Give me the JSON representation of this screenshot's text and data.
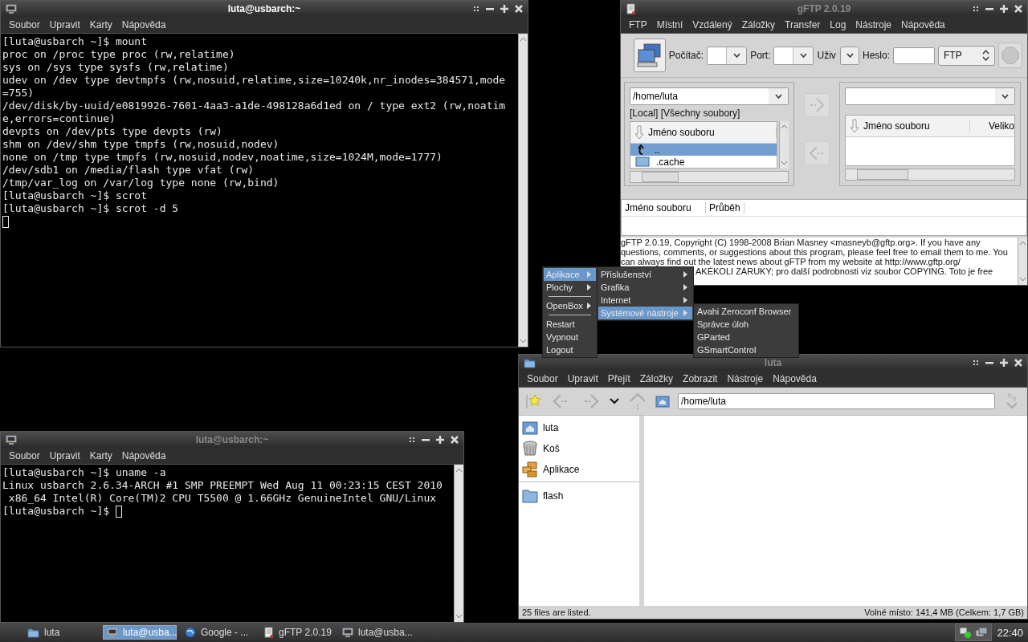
{
  "terminal_top": {
    "title": "luta@usbarch:~",
    "active": true,
    "menu": [
      "Soubor",
      "Upravit",
      "Karty",
      "Nápověda"
    ],
    "lines": [
      "[luta@usbarch ~]$ mount",
      "proc on /proc type proc (rw,relatime)",
      "sys on /sys type sysfs (rw,relatime)",
      "udev on /dev type devtmpfs (rw,nosuid,relatime,size=10240k,nr_inodes=384571,mode",
      "=755)",
      "/dev/disk/by-uuid/e0819926-7601-4aa3-a1de-498128a6d1ed on / type ext2 (rw,noatim",
      "e,errors=continue)",
      "devpts on /dev/pts type devpts (rw)",
      "shm on /dev/shm type tmpfs (rw,nosuid,nodev)",
      "none on /tmp type tmpfs (rw,nosuid,nodev,noatime,size=1024M,mode=1777)",
      "/dev/sdb1 on /media/flash type vfat (rw)",
      "/tmp/var_log on /var/log type none (rw,bind)",
      "[luta@usbarch ~]$ scrot",
      "[luta@usbarch ~]$ scrot -d 5"
    ]
  },
  "gftp": {
    "title": "gFTP 2.0.19",
    "active": false,
    "menu": [
      "FTP",
      "Místní",
      "Vzdálený",
      "Záložky",
      "Transfer",
      "Log",
      "Nástroje",
      "Nápověda"
    ],
    "toolbar": {
      "host_label": "Počítač:",
      "port_label": "Port:",
      "user_label": "Uživ",
      "password_label": "Heslo:",
      "protocol": "FTP"
    },
    "local": {
      "path": "/home/luta",
      "filter": "[Local] [Všechny soubory]",
      "column": "Jméno souboru",
      "files": [
        {
          "name": "..",
          "kind": "up",
          "selected": true
        },
        {
          "name": ".cache",
          "kind": "folder",
          "selected": false
        }
      ]
    },
    "remote": {
      "column": "Jméno souboru",
      "column_2": "Veliko"
    },
    "transfers": {
      "columns": [
        "Jméno souboru",
        "Průběh"
      ]
    },
    "log": [
      {
        "text": "gFTP 2.0.19, Copyright (C) 1998-2008 Brian Masney <masneyb@gftp.org>. If you have any",
        "kind": "full"
      },
      {
        "text": "questions, comments, or suggestions about this program, please feel free to email them to me. You",
        "kind": "full"
      },
      {
        "text": "can always find out the latest news about gFTP from my website at http://www.gftp.org/",
        "kind": "full"
      },
      {
        "text": "AKÉKOLI ZÁRUKY; pro další podrobnosti viz soubor COPYING. Toto je free",
        "kind": "covered"
      }
    ]
  },
  "root_menu": {
    "items": [
      {
        "label": "Aplikace",
        "kind": "submenu",
        "selected": true
      },
      {
        "label": "Plochy",
        "kind": "submenu",
        "selected": false
      },
      {
        "kind": "separator"
      },
      {
        "label": "OpenBox",
        "kind": "submenu",
        "selected": false
      },
      {
        "kind": "separator"
      },
      {
        "label": "Restart",
        "kind": "item",
        "selected": false
      },
      {
        "label": "Vypnout",
        "kind": "item",
        "selected": false
      },
      {
        "label": "Logout",
        "kind": "item",
        "selected": false
      }
    ],
    "submenu": [
      {
        "label": "Příslušenství",
        "kind": "submenu",
        "selected": false
      },
      {
        "label": "Grafika",
        "kind": "submenu",
        "selected": false
      },
      {
        "label": "Internet",
        "kind": "submenu",
        "selected": false
      },
      {
        "label": "Systémové nástroje",
        "kind": "submenu",
        "selected": true
      }
    ],
    "submenu_2": [
      {
        "label": "Avahi Zeroconf Browser",
        "selected": false
      },
      {
        "label": "Správce úloh",
        "selected": false
      },
      {
        "label": "GParted",
        "selected": false
      },
      {
        "label": "GSmartControl",
        "selected": false
      }
    ]
  },
  "file_manager": {
    "title": "luta",
    "active": false,
    "menu": [
      "Soubor",
      "Upravit",
      "Přejít",
      "Záložky",
      "Zobrazit",
      "Nástroje",
      "Nápověda"
    ],
    "path": "/home/luta",
    "places": [
      {
        "label": "luta",
        "kind": "home"
      },
      {
        "label": "Koš",
        "kind": "trash"
      },
      {
        "label": "Aplikace",
        "kind": "apps"
      }
    ],
    "devices": [
      {
        "label": "flash",
        "kind": "folder"
      }
    ],
    "status": "25 files are listed.",
    "free_space": "Volné místo: 141,4 MB (Celkem: 1,7 GB)"
  },
  "terminal_bottom": {
    "title": "luta@usbarch:~",
    "active": false,
    "menu": [
      "Soubor",
      "Upravit",
      "Karty",
      "Nápověda"
    ],
    "lines": [
      "[luta@usbarch ~]$ uname -a",
      "Linux usbarch 2.6.34-ARCH #1 SMP PREEMPT Wed Aug 11 00:23:15 CEST 2010",
      " x86_64 Intel(R) Core(TM)2 CPU T5500 @ 1.66GHz GenuineIntel GNU/Linux",
      "[luta@usbarch ~]$ "
    ]
  },
  "taskbar": {
    "tasks": [
      {
        "label": "luta",
        "kind": "folder",
        "selected": false
      },
      {
        "label": "luta@usba...",
        "kind": "terminal",
        "selected": true
      },
      {
        "label": "Google - ...",
        "kind": "browser",
        "selected": false
      },
      {
        "label": "gFTP 2.0.19",
        "kind": "ftp",
        "selected": false
      },
      {
        "label": "luta@usba...",
        "kind": "terminal",
        "selected": false
      }
    ],
    "clock": "22:40"
  }
}
